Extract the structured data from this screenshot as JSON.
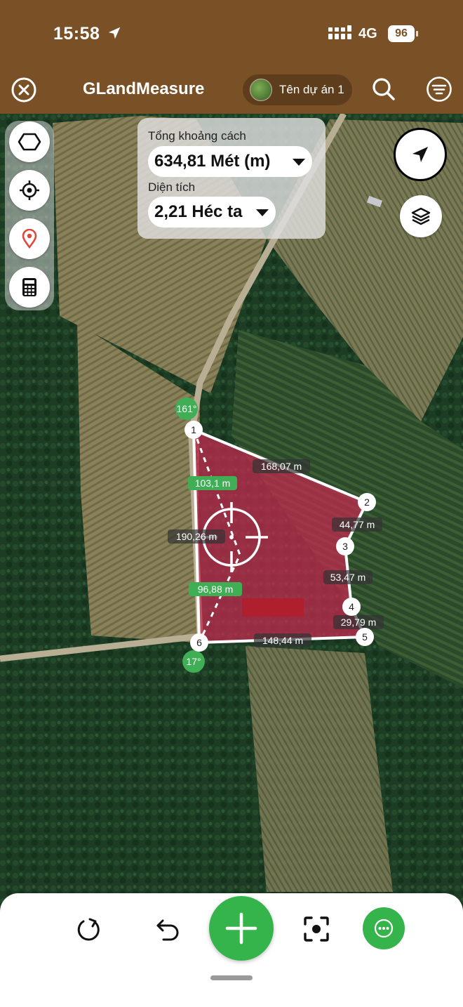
{
  "status_bar": {
    "time": "15:58",
    "network": "4G",
    "battery": "96"
  },
  "app_bar": {
    "title": "GLandMeasure",
    "project_name": "Tên dự án 1"
  },
  "measure_panel": {
    "distance_label": "Tổng khoảng cách",
    "distance_value": "634,81 Mét (m)",
    "area_label": "Diện tích",
    "area_value": "2,21 Héc ta"
  },
  "map": {
    "polygon_fill": "#c8284f",
    "vertices": [
      "1",
      "2",
      "3",
      "4",
      "5",
      "6"
    ],
    "edge_lengths": {
      "e12": "168,07 m",
      "e23": "44,77 m",
      "e34": "53,47 m",
      "e45": "29,79 m",
      "e56": "148,44 m",
      "e61": "190,26 m"
    },
    "diagonal_lengths": {
      "top": "103,1 m",
      "bottom": "96,88 m"
    },
    "angles": {
      "top": "161°",
      "bottom": "17°"
    }
  },
  "icons": {
    "close": "close-circle-icon",
    "search": "search-icon",
    "menu": "menu-lines-icon",
    "side_tools": [
      "polygon-shape-icon",
      "crosshair-target-icon",
      "location-pin-icon",
      "calculator-icon"
    ],
    "navigate": "navigation-arrow-icon",
    "layers": "layers-icon",
    "bottom_tools": [
      "redo-rotate-icon",
      "undo-icon",
      "add-icon",
      "focus-capture-icon",
      "more-options-icon"
    ]
  },
  "colors": {
    "brand_brown": "#7a5026",
    "accent_green": "#35b44b",
    "vertex_green": "#3fae55"
  }
}
